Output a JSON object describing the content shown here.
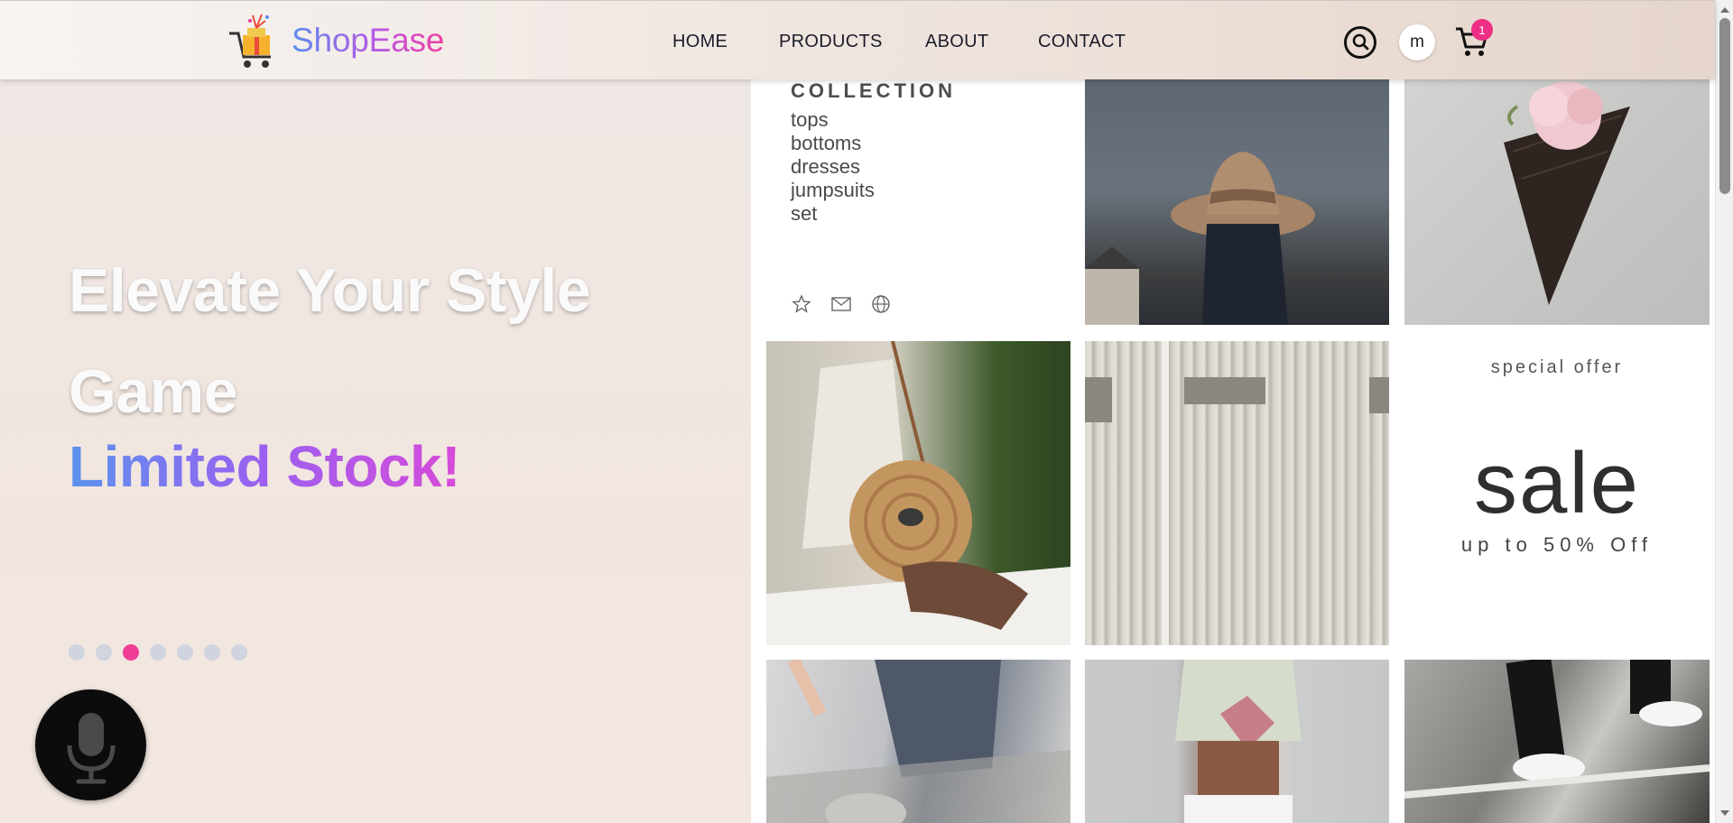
{
  "brand": {
    "name": "ShopEase",
    "logo_icon": "shopping-cart-gift-icon"
  },
  "nav": {
    "items": [
      "HOME",
      "PRODUCTS",
      "ABOUT",
      "CONTACT"
    ]
  },
  "header": {
    "search_icon": "search-icon",
    "avatar_initial": "m",
    "cart_icon": "cart-icon",
    "cart_count": "1"
  },
  "hero": {
    "title": "Elevate Your Style Game",
    "subtitle": "Limited Stock!",
    "carousel": {
      "total": 7,
      "active": 3
    },
    "mic_icon": "microphone-icon"
  },
  "collage": {
    "collection": {
      "title": "COLLECTION",
      "items": [
        "tops",
        "bottoms",
        "dresses",
        "jumpsuits",
        "set"
      ],
      "icons": [
        "star-icon",
        "mail-icon",
        "globe-icon"
      ]
    },
    "offer": {
      "kicker": "special offer",
      "headline": "sale",
      "note": "up to 50% Off"
    }
  },
  "colors": {
    "accent": "#ef3d97",
    "brand_gradient_start": "#5b8def",
    "brand_gradient_end": "#ee3fa0",
    "dot_inactive": "#cfd4de"
  }
}
